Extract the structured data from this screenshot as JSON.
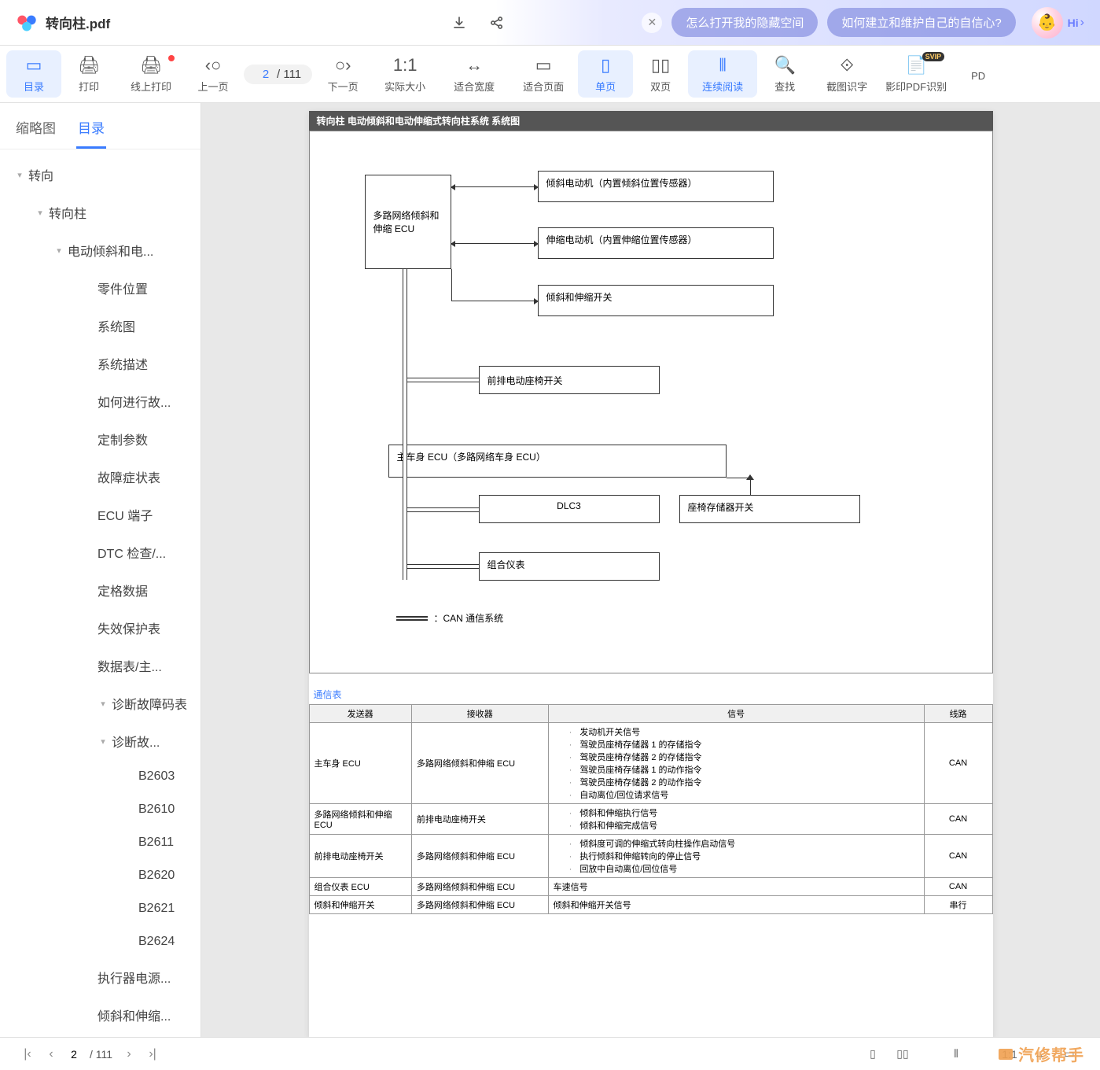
{
  "titlebar": {
    "filename": "转向柱.pdf",
    "pills": [
      "怎么打开我的隐藏空间",
      "如何建立和维护自己的自信心?"
    ],
    "hi": "Hi"
  },
  "toolbar": {
    "items": [
      {
        "icon": "▭",
        "label": "目录",
        "active": true
      },
      {
        "icon": "🖨",
        "label": "打印"
      },
      {
        "icon": "🖨",
        "label": "线上打印",
        "dot": true
      },
      {
        "icon": "‹○",
        "label": "上一页"
      },
      {
        "type": "pageinput",
        "current": "2",
        "total": "/ 111"
      },
      {
        "icon": "○›",
        "label": "下一页"
      },
      {
        "icon": "1:1",
        "label": "实际大小"
      },
      {
        "icon": "↔",
        "label": "适合宽度"
      },
      {
        "icon": "▭",
        "label": "适合页面"
      },
      {
        "icon": "▯",
        "label": "单页",
        "active": true
      },
      {
        "icon": "▯▯",
        "label": "双页"
      },
      {
        "icon": "⫴",
        "label": "连续阅读",
        "active": true
      },
      {
        "icon": "🔍",
        "label": "查找"
      },
      {
        "icon": "⟐",
        "label": "截图识字"
      },
      {
        "icon": "📄",
        "label": "影印PDF识别",
        "svip": true
      },
      {
        "icon": "",
        "label": "PD"
      }
    ]
  },
  "sidebar": {
    "tabs": [
      "缩略图",
      "目录"
    ],
    "activeTab": 1,
    "tree": [
      {
        "level": 0,
        "label": "转向",
        "toggle": "▾"
      },
      {
        "level": 1,
        "label": "转向柱",
        "toggle": "▾"
      },
      {
        "level": 2,
        "label": "电动倾斜和电...",
        "toggle": "▾"
      },
      {
        "level": 3,
        "label": "零件位置"
      },
      {
        "level": 3,
        "label": "系统图"
      },
      {
        "level": 3,
        "label": "系统描述"
      },
      {
        "level": 3,
        "label": "如何进行故..."
      },
      {
        "level": 3,
        "label": "定制参数"
      },
      {
        "level": 3,
        "label": "故障症状表"
      },
      {
        "level": 3,
        "label": "ECU 端子"
      },
      {
        "level": 3,
        "label": "DTC 检查/..."
      },
      {
        "level": 3,
        "label": "定格数据"
      },
      {
        "level": 3,
        "label": "失效保护表"
      },
      {
        "level": 3,
        "label": "数据表/主..."
      },
      {
        "level": 3,
        "label": "诊断故障码表",
        "toggle": "▾"
      },
      {
        "level": 4,
        "label": "诊断故...",
        "toggle": "▾"
      },
      {
        "level": 5,
        "label": "B2603"
      },
      {
        "level": 5,
        "label": "B2610"
      },
      {
        "level": 5,
        "label": "B2611"
      },
      {
        "level": 5,
        "label": "B2620"
      },
      {
        "level": 5,
        "label": "B2621"
      },
      {
        "level": 5,
        "label": "B2624"
      },
      {
        "level": 3,
        "label": "执行器电源..."
      },
      {
        "level": 3,
        "label": "倾斜和伸缩..."
      }
    ]
  },
  "page": {
    "header": "转向柱  电动倾斜和电动伸缩式转向柱系统  系统图",
    "diagram": {
      "ecu": "多路网络倾斜和伸缩 ECU",
      "tilt_motor": "倾斜电动机（内置倾斜位置传感器）",
      "tele_motor": "伸缩电动机（内置伸缩位置传感器）",
      "switch": "倾斜和伸缩开关",
      "front_seat": "前排电动座椅开关",
      "main_body": "主车身 ECU（多路网络车身 ECU）",
      "dlc3": "DLC3",
      "seat_mem": "座椅存储器开关",
      "meter": "组合仪表",
      "can_legend": "：CAN 通信系统"
    },
    "comm_title": "通信表",
    "comm_headers": [
      "发送器",
      "接收器",
      "信号",
      "线路"
    ],
    "comm_rows": [
      {
        "sender": "主车身 ECU",
        "receiver": "多路网络倾斜和伸缩 ECU",
        "signals": [
          "发动机开关信号",
          "驾驶员座椅存储器 1 的存储指令",
          "驾驶员座椅存储器 2 的存储指令",
          "驾驶员座椅存储器 1 的动作指令",
          "驾驶员座椅存储器 2 的动作指令",
          "自动离位/回位请求信号"
        ],
        "line": "CAN"
      },
      {
        "sender": "多路网络倾斜和伸缩 ECU",
        "receiver": "前排电动座椅开关",
        "signals": [
          "倾斜和伸缩执行信号",
          "倾斜和伸缩完成信号"
        ],
        "line": "CAN"
      },
      {
        "sender": "前排电动座椅开关",
        "receiver": "多路网络倾斜和伸缩 ECU",
        "signals": [
          "倾斜度可调的伸缩式转向柱操作启动信号",
          "执行倾斜和伸缩转向的停止信号",
          "回放中自动离位/回位信号"
        ],
        "line": "CAN"
      },
      {
        "sender": "组合仪表 ECU",
        "receiver": "多路网络倾斜和伸缩 ECU",
        "signals_text": "车速信号",
        "line": "CAN"
      },
      {
        "sender": "倾斜和伸缩开关",
        "receiver": "多路网络倾斜和伸缩 ECU",
        "signals_text": "倾斜和伸缩开关信号",
        "line": "串行"
      }
    ]
  },
  "bottombar": {
    "current": "2",
    "total": "/ 111"
  },
  "watermark": "汽修帮手"
}
